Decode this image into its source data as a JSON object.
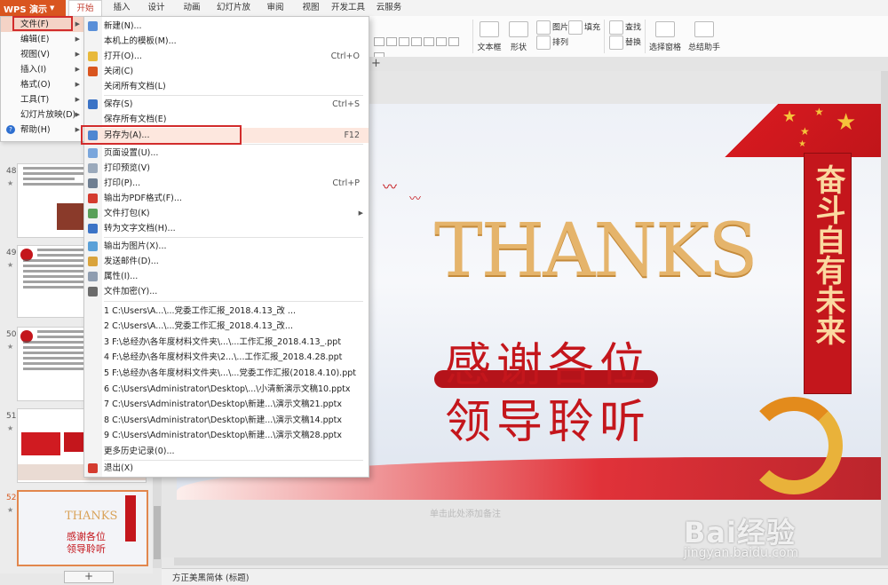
{
  "app": {
    "brand": "WPS 演示",
    "brand_color": "#d9551f"
  },
  "tabs": [
    "开始",
    "插入",
    "设计",
    "动画",
    "幻灯片放映",
    "审阅",
    "视图",
    "开发工具",
    "云服务"
  ],
  "ribbon": {
    "textbox": "文本框",
    "shape": "形状",
    "picture": "图片",
    "fill": "填充",
    "arrange": "排列",
    "find": "查找",
    "replace": "替换",
    "select_pane": "选择窗格",
    "summary": "总结助手"
  },
  "main_menu": {
    "items": [
      {
        "label": "文件(F)",
        "has_sub": true
      },
      {
        "label": "编辑(E)",
        "has_sub": true
      },
      {
        "label": "视图(V)",
        "has_sub": true
      },
      {
        "label": "插入(I)",
        "has_sub": true
      },
      {
        "label": "格式(O)",
        "has_sub": true
      },
      {
        "label": "工具(T)",
        "has_sub": true
      },
      {
        "label": "幻灯片放映(D)",
        "has_sub": true
      },
      {
        "label": "帮助(H)",
        "has_sub": true
      }
    ]
  },
  "file_menu": {
    "items": [
      {
        "label": "新建(N)...",
        "shortcut": "",
        "icon": "new-icon"
      },
      {
        "label": "本机上的模板(M)...",
        "shortcut": "",
        "icon": ""
      },
      {
        "label": "打开(O)...",
        "shortcut": "Ctrl+O",
        "icon": "open-folder-icon"
      },
      {
        "label": "关闭(C)",
        "shortcut": "",
        "icon": "close-doc-icon"
      },
      {
        "label": "关闭所有文档(L)",
        "shortcut": "",
        "icon": ""
      },
      {
        "label": "保存(S)",
        "shortcut": "Ctrl+S",
        "icon": "save-icon"
      },
      {
        "label": "保存所有文档(E)",
        "shortcut": "",
        "icon": ""
      },
      {
        "label": "另存为(A)...",
        "shortcut": "F12",
        "icon": "save-as-icon"
      },
      {
        "label": "页面设置(U)...",
        "shortcut": "",
        "icon": "page-setup-icon"
      },
      {
        "label": "打印预览(V)",
        "shortcut": "",
        "icon": "print-preview-icon"
      },
      {
        "label": "打印(P)...",
        "shortcut": "Ctrl+P",
        "icon": "print-icon"
      },
      {
        "label": "输出为PDF格式(F)...",
        "shortcut": "",
        "icon": "pdf-icon"
      },
      {
        "label": "文件打包(K)",
        "shortcut": "",
        "icon": "package-icon"
      },
      {
        "label": "转为文字文档(H)...",
        "shortcut": "",
        "icon": "convert-icon"
      },
      {
        "label": "输出为图片(X)...",
        "shortcut": "",
        "icon": "image-export-icon"
      },
      {
        "label": "发送邮件(D)...",
        "shortcut": "",
        "icon": "mail-icon"
      },
      {
        "label": "属性(I)...",
        "shortcut": "",
        "icon": "properties-icon"
      },
      {
        "label": "文件加密(Y)...",
        "shortcut": "",
        "icon": "encrypt-icon"
      }
    ],
    "recent": [
      "1 C:\\Users\\A...\\...党委工作汇报_2018.4.13_改 ...",
      "2 C:\\Users\\A...\\...党委工作汇报_2018.4.13_改...",
      "3 F:\\总经办\\各年度材料文件夹\\...\\...工作汇报_2018.4.13_.ppt",
      "4 F:\\总经办\\各年度材料文件夹\\2...\\...工作汇报_2018.4.28.ppt",
      "5 F:\\总经办\\各年度材料文件夹\\...\\...党委工作汇报(2018.4.10).ppt",
      "6 C:\\Users\\Administrator\\Desktop\\...\\小清新演示文稿10.pptx",
      "7 C:\\Users\\Administrator\\Desktop\\新建...\\演示文稿21.pptx",
      "8 C:\\Users\\Administrator\\Desktop\\新建...\\演示文稿14.pptx",
      "9 C:\\Users\\Administrator\\Desktop\\新建...\\演示文稿28.pptx"
    ],
    "more_history": "更多历史记录(0)...",
    "exit": "退出(X)"
  },
  "thumbnails": [
    {
      "num": "48",
      "star": "★"
    },
    {
      "num": "49",
      "star": "★"
    },
    {
      "num": "50",
      "star": "★"
    },
    {
      "num": "51",
      "star": "★"
    },
    {
      "num": "52",
      "star": "★",
      "active": true
    }
  ],
  "thumb52": {
    "thanks": "THANKS",
    "line1": "感谢各位",
    "line2": "领导聆听"
  },
  "slide": {
    "thanks": "THANKS",
    "line1": "感谢各位",
    "line2": "领导聆听",
    "banner": "奋斗自有未来",
    "accent_color": "#c4161c",
    "notes_hint": "单击此处添加备注"
  },
  "statusbar": {
    "font": "方正美黑简体 (标题)"
  },
  "add_slide": "+",
  "watermark": {
    "logo": "Bai经验",
    "sub": "jingyan.baidu.com"
  }
}
